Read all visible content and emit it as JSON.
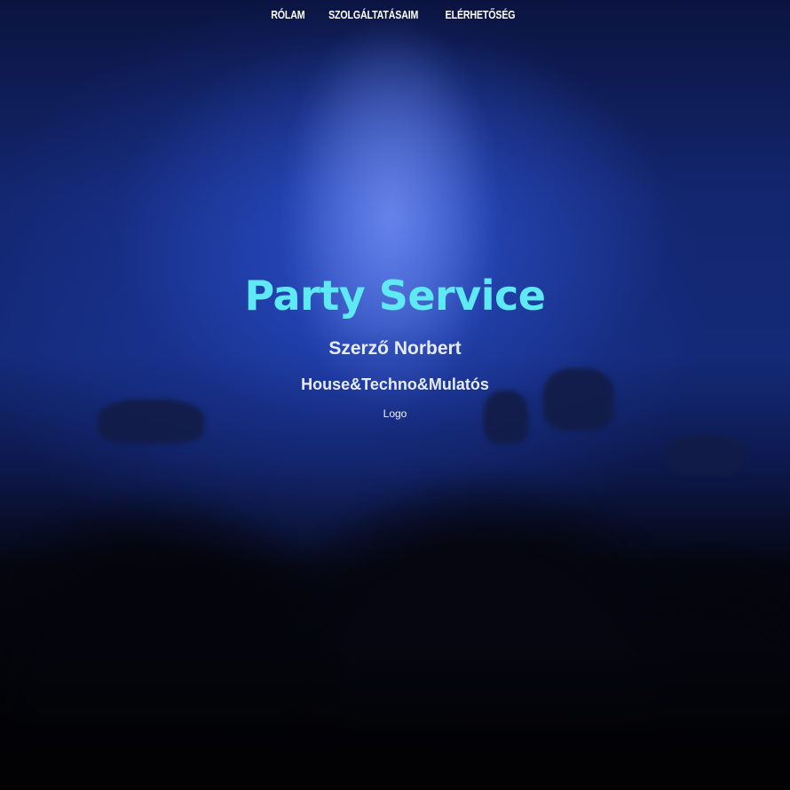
{
  "nav": {
    "items": [
      {
        "label": "RÓLAM"
      },
      {
        "label": "SZOLGÁLTATÁSAIM"
      },
      {
        "label": "ELÉRHETŐSÉG"
      }
    ]
  },
  "hero": {
    "title": "Party Service",
    "name": "Szerző Norbert",
    "genres": "House&Techno&Mulatós",
    "logo_alt": "Logo"
  },
  "colors": {
    "title": "#5ee9f5",
    "background_light": "#142a78",
    "background_dark": "#020205"
  },
  "background": {
    "image": "blurred concert crowd with blue stage light"
  }
}
